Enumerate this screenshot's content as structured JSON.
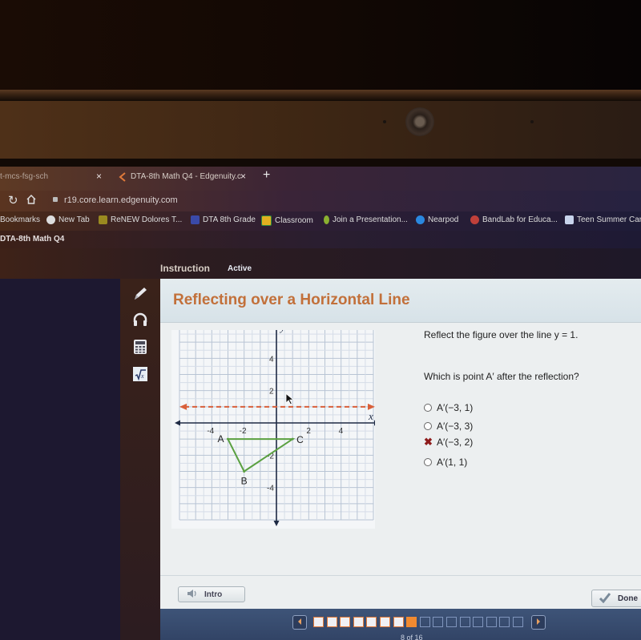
{
  "browser": {
    "tabs": [
      {
        "label": "t-mcs-fsg-sch",
        "active": false
      },
      {
        "label": "DTA-8th Math Q4 - Edgenuity.c",
        "active": true
      }
    ],
    "new_tab_symbol": "+",
    "close_symbol": "×",
    "address": "r19.core.learn.edgenuity.com",
    "bookmarks": [
      {
        "label": "Bookmarks",
        "icon": "none"
      },
      {
        "label": "New Tab",
        "icon": "globe-icon"
      },
      {
        "label": "ReNEW Dolores T...",
        "icon": "shield-icon"
      },
      {
        "label": "DTA 8th Grade",
        "icon": "calendar-icon"
      },
      {
        "label": "Classroom",
        "icon": "classroom-icon"
      },
      {
        "label": "Join a Presentation...",
        "icon": "pear-icon"
      },
      {
        "label": "Nearpod",
        "icon": "nearpod-icon"
      },
      {
        "label": "BandLab for Educa...",
        "icon": "bandlab-icon"
      },
      {
        "label": "Teen Summer Car",
        "icon": "teen-summer-icon"
      }
    ]
  },
  "course": {
    "title": "DTA-8th Math Q4",
    "nav_tabs": [
      {
        "label": "Instruction",
        "active": false
      },
      {
        "label": "Active",
        "active": true
      }
    ]
  },
  "tools": [
    {
      "name": "pencil-icon"
    },
    {
      "name": "headphones-icon"
    },
    {
      "name": "calculator-icon"
    },
    {
      "name": "formula-icon"
    }
  ],
  "lesson": {
    "title": "Reflecting over a Horizontal Line",
    "question_line1": "Reflect the figure over the line y = 1.",
    "question_line2": "Which is point A′ after the reflection?",
    "options": [
      {
        "label": "A′(−3, 1)",
        "state": "unselected"
      },
      {
        "label": "A′(−3, 3)",
        "state": "unselected"
      },
      {
        "label": "A′(−3, 2)",
        "state": "incorrect"
      },
      {
        "label": "A′(1, 1)",
        "state": "unselected"
      }
    ],
    "intro_label": "Intro",
    "done_label": "Done"
  },
  "graph": {
    "x_axis_label": "x",
    "y_axis_label": "y",
    "range": [
      -6,
      6
    ],
    "tick_labels_x": [
      "-4",
      "-2",
      "2",
      "4"
    ],
    "tick_labels_y": [
      "4",
      "2",
      "-2",
      "-4"
    ],
    "reflection_line_y": 1,
    "reflection_line_color": "#d9603a",
    "triangle_color": "#5aa040",
    "points": [
      {
        "label": "A",
        "x": -3,
        "y": -1
      },
      {
        "label": "B",
        "x": -2,
        "y": -3
      },
      {
        "label": "C",
        "x": 1,
        "y": -1
      }
    ]
  },
  "pager": {
    "current": 8,
    "total": 16,
    "label": "8 of 16",
    "completed_color": "#e07a3a",
    "current_color": "#f08a30",
    "upcoming_color": "#7f95bc"
  },
  "colors": {
    "title_orange": "#c2703a",
    "incorrect_red": "#8e1b1b"
  }
}
